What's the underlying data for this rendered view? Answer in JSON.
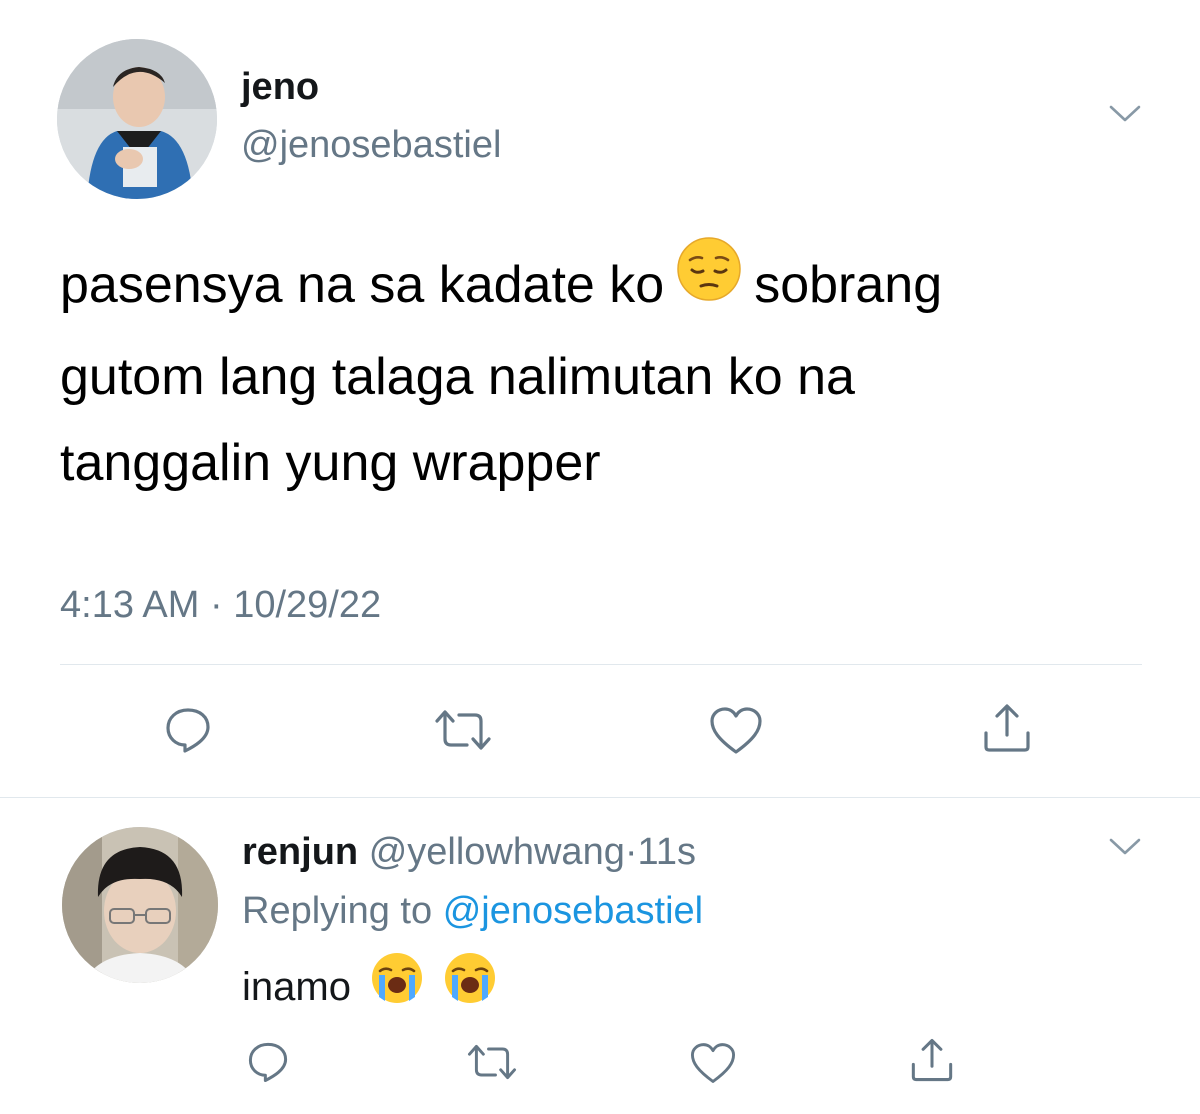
{
  "main_tweet": {
    "display_name": "jeno",
    "handle": "@jenosebastiel",
    "text_line1_a": "pasensya na sa kadate ko",
    "text_line1_b": "sobrang",
    "text_line2": "gutom lang talaga nalimutan ko na",
    "text_line3": "tanggalin yung wrapper",
    "emoji": "pensive-face",
    "time": "4:13 AM",
    "separator": "·",
    "date": "10/29/22",
    "actions": [
      "reply-icon",
      "retweet-icon",
      "like-icon",
      "share-icon"
    ]
  },
  "reply": {
    "display_name": "renjun",
    "handle": "@yellowhwang",
    "separator": "·",
    "age": "11s",
    "replying_prefix": "Replying to",
    "replying_handle": "@jenosebastiel",
    "text": "inamo",
    "emojis": [
      "loudly-crying-face",
      "loudly-crying-face"
    ],
    "actions": [
      "reply-icon",
      "retweet-icon",
      "like-icon",
      "share-icon"
    ]
  },
  "colors": {
    "text": "#000000",
    "name": "#14171a",
    "muted": "#657786",
    "link": "#1b95e0",
    "divider": "#e1e8ed"
  }
}
